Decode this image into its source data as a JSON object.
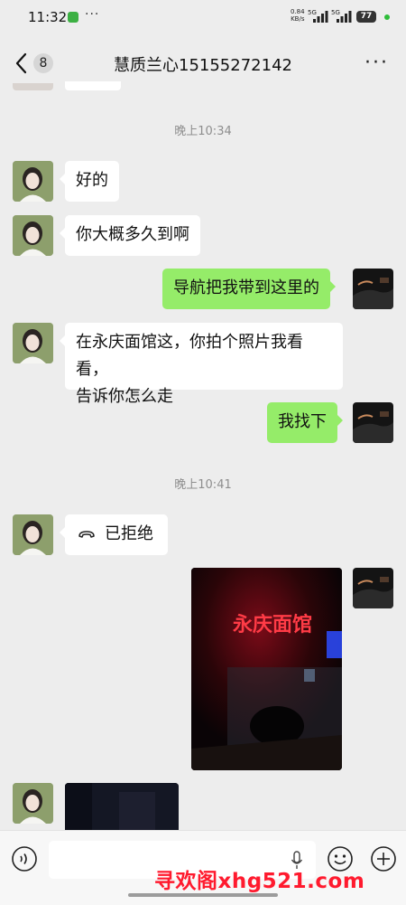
{
  "status_bar": {
    "time": "11:32",
    "more": "···",
    "net_speed": "0.84",
    "net_unit": "KB/s",
    "signal_1": "5G",
    "signal_2": "5G",
    "battery": "77"
  },
  "header": {
    "unread_count": "8",
    "title": "慧质兰心15155272142",
    "more": "···"
  },
  "messages": {
    "timestamp_1": "晚上10:34",
    "msg_1": "好的",
    "msg_2": "你大概多久到啊",
    "msg_3": "导航把我带到这里的",
    "msg_4_line1": "在永庆面馆这，你拍个照片我看看，",
    "msg_4_line2": "告诉你怎么走",
    "msg_5": "我找下",
    "timestamp_2": "晚上10:41",
    "call_status": "已拒绝",
    "photo_sign_text": "永庆面馆"
  },
  "input_bar": {
    "placeholder": ""
  },
  "watermark": "寻欢阁xhg521.com",
  "colors": {
    "bg": "#ededed",
    "outgoing_bubble": "#95ec69",
    "incoming_bubble": "#ffffff",
    "watermark": "#ff1a2e"
  }
}
